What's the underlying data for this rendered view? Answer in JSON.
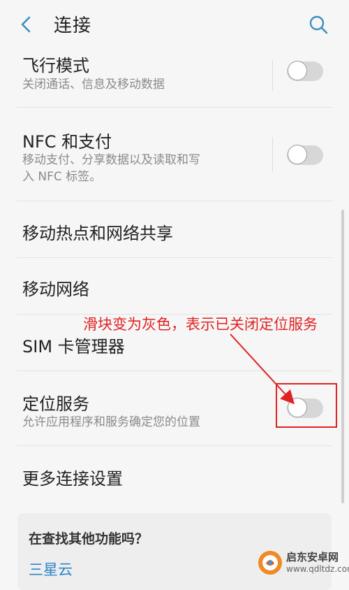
{
  "header": {
    "title": "连接",
    "back_icon": "chevron-left-icon",
    "search_icon": "search-icon"
  },
  "settings": [
    {
      "title": "飞行模式",
      "subtitle": "关闭通话、信息及移动数据",
      "toggle": "off"
    },
    {
      "title": "NFC 和支付",
      "subtitle_lines": [
        "移动支付、分享数据以及读取和写",
        "入 NFC 标签。"
      ],
      "toggle": "off"
    },
    {
      "title": "移动热点和网络共享"
    },
    {
      "title": "移动网络"
    },
    {
      "title": "SIM 卡管理器"
    },
    {
      "title": "定位服务",
      "subtitle": "允许应用程序和服务确定您的位置",
      "toggle": "off"
    },
    {
      "title": "更多连接设置"
    }
  ],
  "annotation": {
    "text": "滑块变为灰色，表示已关闭定位服务",
    "color": "#e02222"
  },
  "card": {
    "title": "在查找其他功能吗？",
    "link": "三星云"
  },
  "watermark": {
    "line1": "启东安卓网",
    "line2": "www.qdltdz.com"
  },
  "colors": {
    "accent": "#2c86c9",
    "toggle_off_track": "#d7d7d7",
    "annotation": "#e02222"
  }
}
